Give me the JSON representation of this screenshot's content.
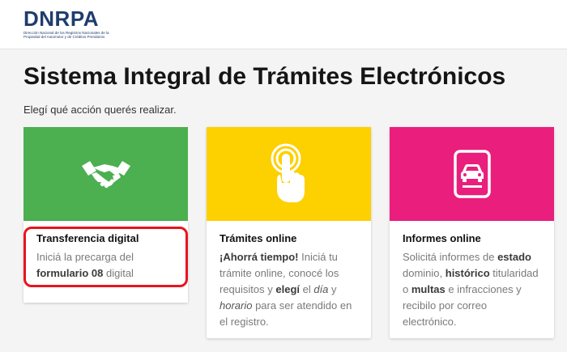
{
  "header": {
    "logo_text": "DNRPA",
    "logo_sub": "Dirección Nacional de los Registros Nacionales de la Propiedad del Automotor y de Créditos Prendarios"
  },
  "page": {
    "title": "Sistema Integral de Trámites Electrónicos",
    "subtitle": "Elegí qué acción querés realizar."
  },
  "cards": [
    {
      "title": "Transferencia digital",
      "color": "#4caf50",
      "icon": "handshake-icon",
      "desc_1": "Iniciá la precarga del ",
      "desc_bold_1": "formulario 08",
      "desc_2": " digital"
    },
    {
      "title": "Trámites online",
      "color": "#fdd000",
      "icon": "touch-finger-icon",
      "bold_1": "¡Ahorrá tiempo!",
      "text_1": " Iniciá tu trámite online, conocé los requisitos y ",
      "bold_2": "elegí",
      "text_2": " el ",
      "italic_1": "día",
      "text_3": " y ",
      "italic_2": "horario",
      "text_4": " para ser atendido en el registro."
    },
    {
      "title": "Informes online",
      "color": "#e91e7d",
      "icon": "car-document-icon",
      "text_1": "Solicitá informes de ",
      "bold_1": "estado",
      "text_2": " dominio, ",
      "bold_2": "histórico",
      "text_3": " titularidad o ",
      "bold_3": "multas",
      "text_4": " e infracciones y recibilo por correo electrónico."
    }
  ]
}
